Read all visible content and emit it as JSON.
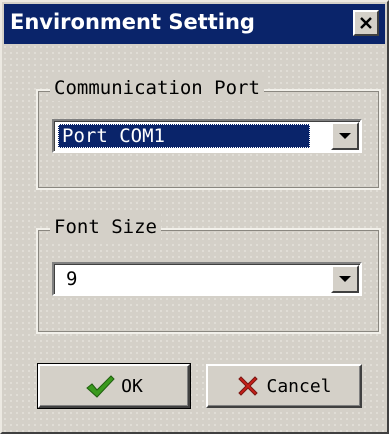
{
  "window": {
    "title": "Environment Setting"
  },
  "communication_port": {
    "legend": "Communication Port",
    "selected_value": "Port COM1"
  },
  "font_size": {
    "legend": "Font Size",
    "selected_value": "9"
  },
  "buttons": {
    "ok_label": "OK",
    "cancel_label": "Cancel"
  },
  "colors": {
    "titlebar": "#0a246a",
    "dialog_face": "#d4d0c8",
    "ok_check": "#3a9a1e",
    "cancel_x": "#c8201a"
  },
  "icons": {
    "close": "close-icon",
    "dropdown": "chevron-down-icon",
    "ok": "check-icon",
    "cancel": "x-icon"
  }
}
